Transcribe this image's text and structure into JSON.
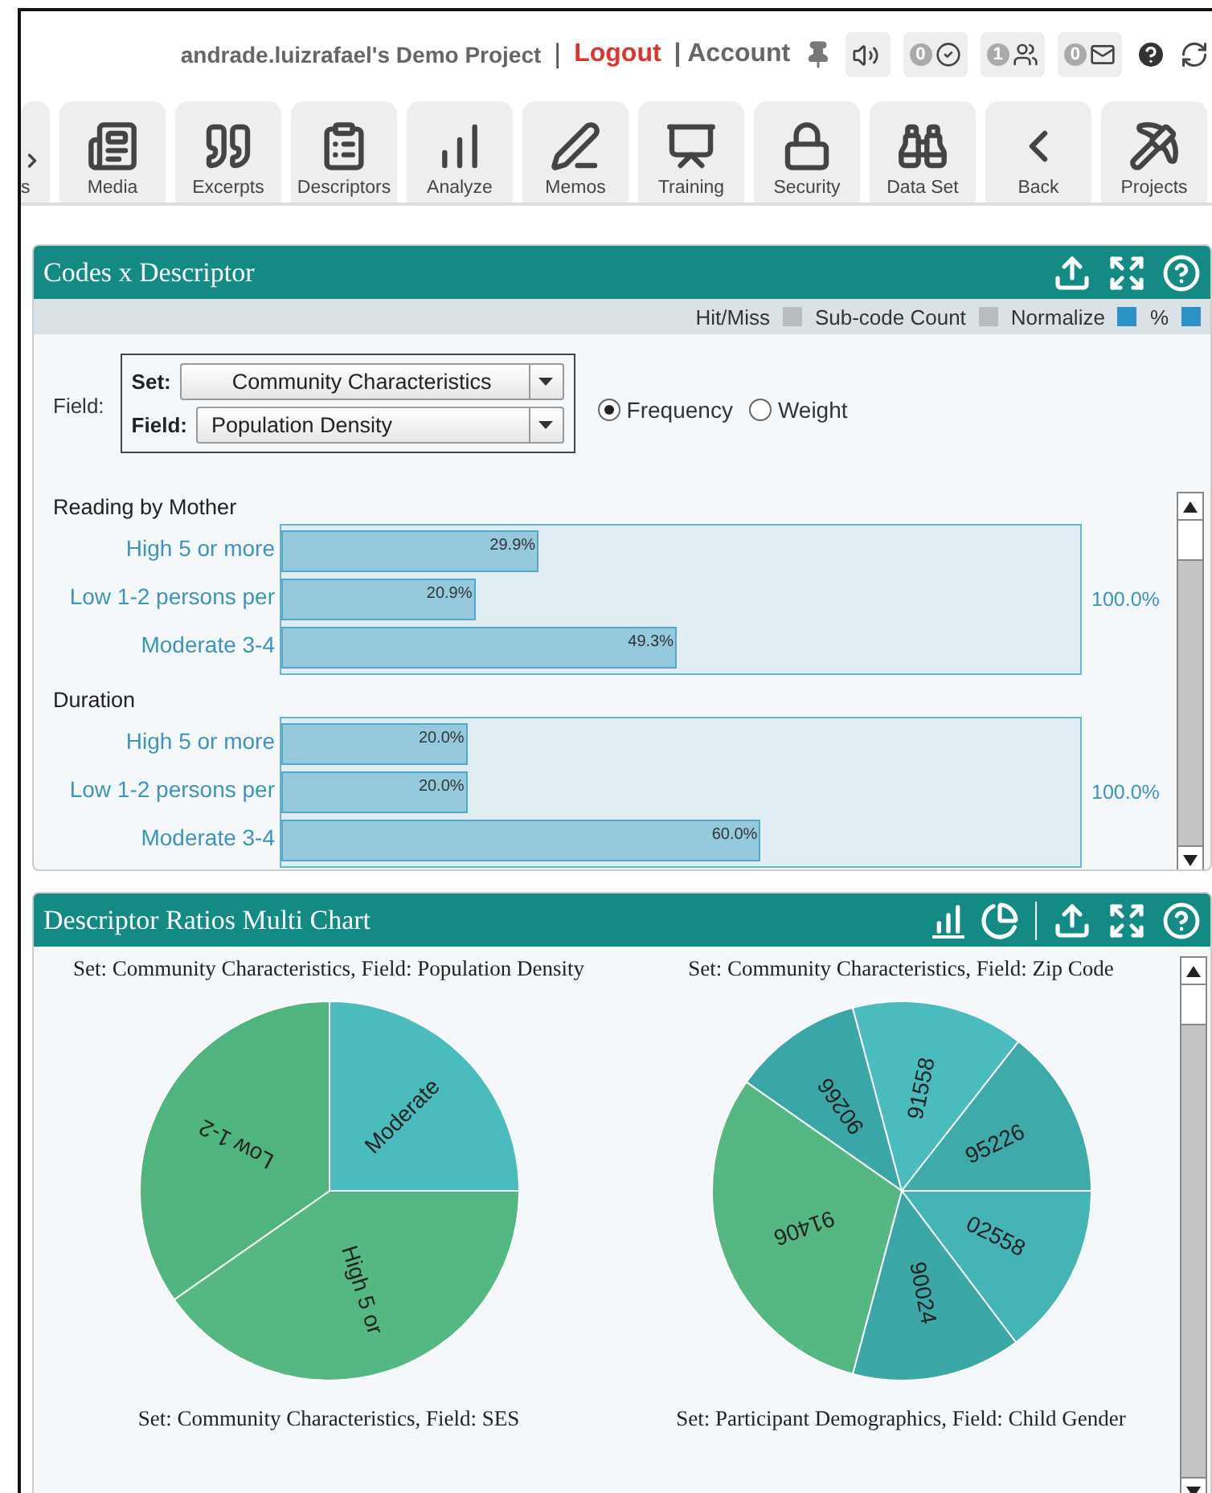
{
  "header": {
    "project": "andrade.luizrafael's Demo Project",
    "separator": "|",
    "logout": "Logout",
    "account": "| Account",
    "badges": [
      {
        "count": "0"
      },
      {
        "count": "1"
      },
      {
        "count": "0"
      }
    ]
  },
  "toolbar": {
    "tabs": [
      {
        "label": "s"
      },
      {
        "label": "Media"
      },
      {
        "label": "Excerpts"
      },
      {
        "label": "Descriptors"
      },
      {
        "label": "Analyze"
      },
      {
        "label": "Memos"
      },
      {
        "label": "Training"
      },
      {
        "label": "Security"
      },
      {
        "label": "Data Set"
      },
      {
        "label": "Back"
      },
      {
        "label": "Projects"
      }
    ]
  },
  "codes_panel": {
    "title": "Codes x Descriptor",
    "toggles": [
      {
        "label": "Hit/Miss",
        "checked": false
      },
      {
        "label": "Sub-code Count",
        "checked": false
      },
      {
        "label": "Normalize",
        "checked": true
      },
      {
        "label": "%",
        "checked": true
      }
    ],
    "field_label": "Field:",
    "set": {
      "label": "Set:",
      "value": "Community Characteristics"
    },
    "field": {
      "label": "Field:",
      "value": "Population Density"
    },
    "modes": [
      {
        "label": "Frequency",
        "selected": true
      },
      {
        "label": "Weight",
        "selected": false
      }
    ],
    "groups": [
      {
        "title": "Reading by Mother",
        "total": "100.0%",
        "rows": [
          {
            "label": "High 5 or more",
            "level": 0.322,
            "reading": "29.9%"
          },
          {
            "label": "Low 1-2 persons per",
            "level": 0.243,
            "reading": "20.9%"
          },
          {
            "label": "Moderate 3-4",
            "level": 0.495,
            "reading": "49.3%"
          }
        ]
      },
      {
        "title": "Duration",
        "total": "100.0%",
        "rows": [
          {
            "label": "High 5 or more",
            "level": 0.233,
            "reading": "20.0%"
          },
          {
            "label": "Low 1-2 persons per",
            "level": 0.233,
            "reading": "20.0%"
          },
          {
            "label": "Moderate 3-4",
            "level": 0.6,
            "reading": "60.0%"
          }
        ]
      }
    ]
  },
  "ratios_panel": {
    "title": "Descriptor Ratios Multi Chart",
    "charts": [
      {
        "title": "Set: Community Characteristics, Field: Population Density",
        "slices": [
          {
            "label": "Moderate",
            "color": "#4bbcbd"
          },
          {
            "label": "High 5 or",
            "color": "#55b883"
          },
          {
            "label": "Low 1-2",
            "color": "#4fb47e"
          }
        ]
      },
      {
        "title": "Set: Community Characteristics, Field: Zip Code",
        "slices": [
          {
            "label": "90266",
            "color": "#3aa6a8"
          },
          {
            "label": "91558",
            "color": "#4bbcbd"
          },
          {
            "label": "95226",
            "color": "#3eaaaa"
          },
          {
            "label": "02558",
            "color": "#45b4b6"
          },
          {
            "label": "90024",
            "color": "#3ba7a7"
          },
          {
            "label": "91406",
            "color": "#55b883"
          }
        ]
      },
      {
        "title": "Set: Community Characteristics, Field: SES"
      },
      {
        "title": "Set: Participant Demographics, Field: Child Gender"
      }
    ]
  }
}
